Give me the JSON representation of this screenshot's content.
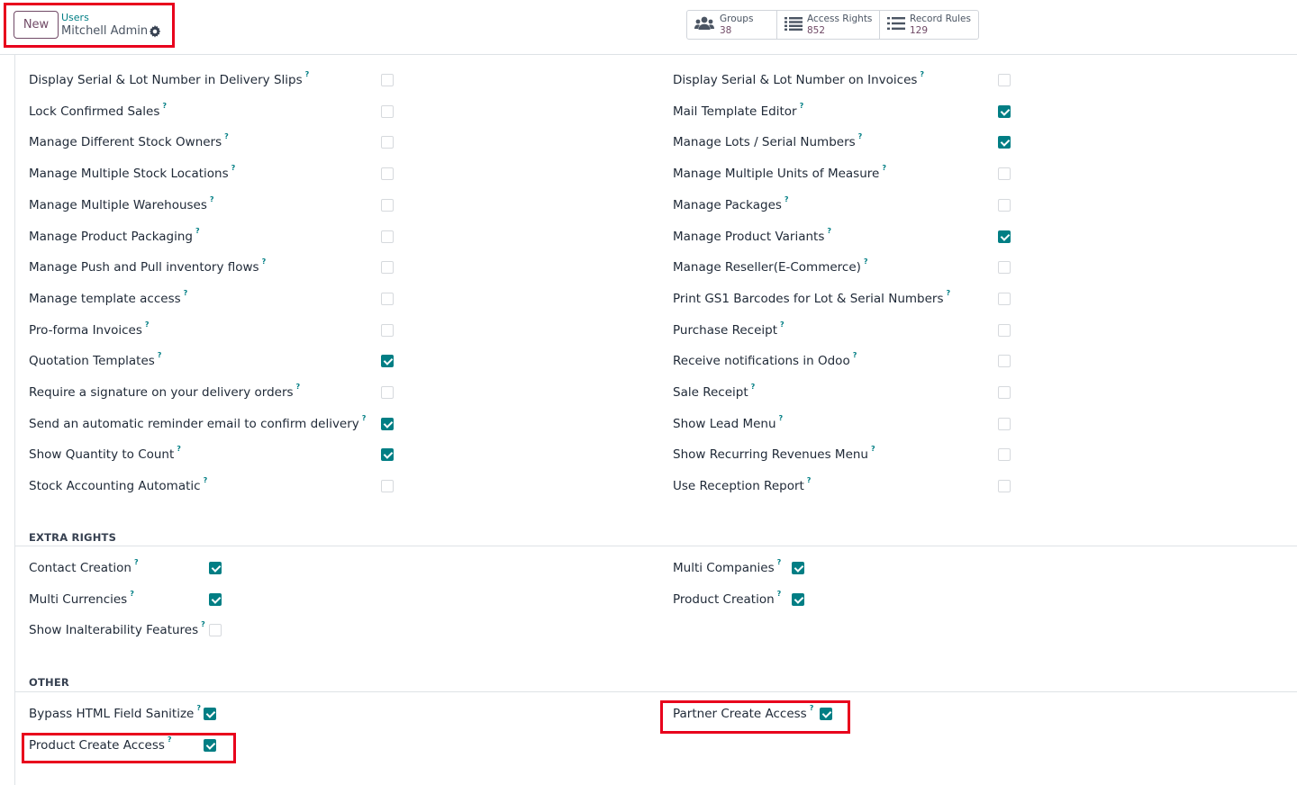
{
  "control_panel": {
    "new_label": "New",
    "breadcrumb_parent": "Users",
    "breadcrumb_current": "Mitchell Admin",
    "stats": [
      {
        "label": "Groups",
        "value": "38",
        "icon": "users-icon"
      },
      {
        "label": "Access Rights",
        "value": "852",
        "icon": "list-icon"
      },
      {
        "label": "Record Rules",
        "value": "129",
        "icon": "list-icon"
      }
    ]
  },
  "technical_settings": {
    "left": [
      {
        "label": "Display Serial & Lot Number in Delivery Slips",
        "checked": false
      },
      {
        "label": "Lock Confirmed Sales",
        "checked": false
      },
      {
        "label": "Manage Different Stock Owners",
        "checked": false
      },
      {
        "label": "Manage Multiple Stock Locations",
        "checked": false
      },
      {
        "label": "Manage Multiple Warehouses",
        "checked": false
      },
      {
        "label": "Manage Product Packaging",
        "checked": false
      },
      {
        "label": "Manage Push and Pull inventory flows",
        "checked": false
      },
      {
        "label": "Manage template access",
        "checked": false
      },
      {
        "label": "Pro-forma Invoices",
        "checked": false
      },
      {
        "label": "Quotation Templates",
        "checked": true
      },
      {
        "label": "Require a signature on your delivery orders",
        "checked": false
      },
      {
        "label": "Send an automatic reminder email to confirm delivery",
        "checked": true
      },
      {
        "label": "Show Quantity to Count",
        "checked": true
      },
      {
        "label": "Stock Accounting Automatic",
        "checked": false
      }
    ],
    "right": [
      {
        "label": "Display Serial & Lot Number on Invoices",
        "checked": false
      },
      {
        "label": "Mail Template Editor",
        "checked": true
      },
      {
        "label": "Manage Lots / Serial Numbers",
        "checked": true
      },
      {
        "label": "Manage Multiple Units of Measure",
        "checked": false
      },
      {
        "label": "Manage Packages",
        "checked": false
      },
      {
        "label": "Manage Product Variants",
        "checked": true
      },
      {
        "label": "Manage Reseller(E-Commerce)",
        "checked": false
      },
      {
        "label": "Print GS1 Barcodes for Lot & Serial Numbers",
        "checked": false
      },
      {
        "label": "Purchase Receipt",
        "checked": false
      },
      {
        "label": "Receive notifications in Odoo",
        "checked": false
      },
      {
        "label": "Sale Receipt",
        "checked": false
      },
      {
        "label": "Show Lead Menu",
        "checked": false
      },
      {
        "label": "Show Recurring Revenues Menu",
        "checked": false
      },
      {
        "label": "Use Reception Report",
        "checked": false
      }
    ]
  },
  "extra_rights": {
    "title": "EXTRA RIGHTS",
    "left": [
      {
        "label": "Contact Creation",
        "checked": true
      },
      {
        "label": "Multi Currencies",
        "checked": true
      },
      {
        "label": "Show Inalterability Features",
        "checked": false
      }
    ],
    "right": [
      {
        "label": "Multi Companies",
        "checked": true
      },
      {
        "label": "Product Creation",
        "checked": true
      }
    ]
  },
  "other": {
    "title": "OTHER",
    "left": [
      {
        "label": "Bypass HTML Field Sanitize",
        "checked": true
      },
      {
        "label": "Product Create Access",
        "checked": true
      }
    ],
    "right": [
      {
        "label": "Partner Create Access",
        "checked": true
      }
    ]
  },
  "help_marker": "?",
  "colors": {
    "accent": "#017e84",
    "brand": "#714b67",
    "highlight": "#e8001c"
  }
}
